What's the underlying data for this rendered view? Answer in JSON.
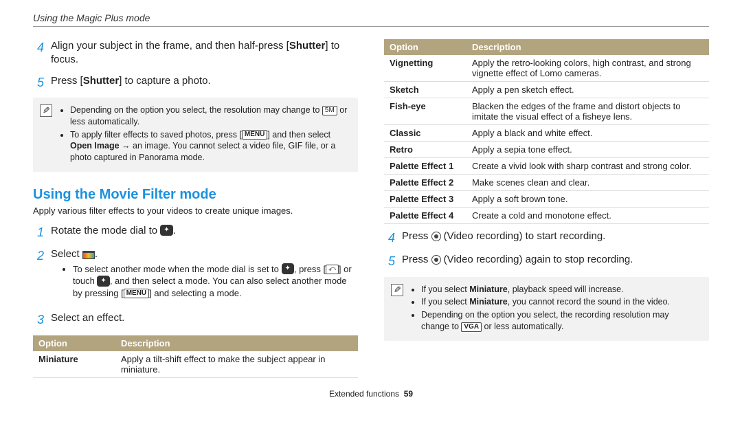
{
  "breadcrumb": "Using the Magic Plus mode",
  "left": {
    "step4_a": "Align your subject in the frame, and then half-press [",
    "step4_b": "Shutter",
    "step4_c": "] to focus.",
    "step5_a": "Press [",
    "step5_b": "Shutter",
    "step5_c": "] to capture a photo.",
    "notes": {
      "n1_a": "Depending on the option you select, the resolution may change to ",
      "n1_icon": "5M",
      "n1_b": " or less automatically.",
      "n2_a": "To apply filter effects to saved photos, press [",
      "n2_menu": "MENU",
      "n2_b": "] and then select ",
      "n2_bold": "Open Image",
      "n2_c": " → an image. You cannot select a video file, GIF file, or a photo captured in Panorama mode."
    },
    "section_title": "Using the Movie Filter mode",
    "section_desc": "Apply various filter effects to your videos to create unique images.",
    "mf_step1_a": "Rotate the mode dial to ",
    "mf_step1_icon": "✦",
    "mf_step1_b": ".",
    "mf_step2_a": "Select ",
    "mf_step2_b": ".",
    "mf_sub_a": "To select another mode when the mode dial is set to ",
    "mf_sub_icon1": "✦",
    "mf_sub_b": ", press [",
    "mf_sub_icon2": "⤺",
    "mf_sub_c": "] or touch ",
    "mf_sub_icon3": "✦",
    "mf_sub_d": ", and then select a mode. You can also select another mode by pressing [",
    "mf_sub_menu": "MENU",
    "mf_sub_e": "] and selecting a mode.",
    "mf_step3": "Select an effect.",
    "table_h1": "Option",
    "table_h2": "Description",
    "t_miniature": "Miniature",
    "t_miniature_desc": "Apply a tilt-shift effect to make the subject appear in miniature."
  },
  "right": {
    "table_h1": "Option",
    "table_h2": "Description",
    "rows": {
      "vignetting": {
        "o": "Vignetting",
        "d": "Apply the retro-looking colors, high contrast, and strong vignette effect of Lomo cameras."
      },
      "sketch": {
        "o": "Sketch",
        "d": "Apply a pen sketch effect."
      },
      "fisheye": {
        "o": "Fish-eye",
        "d": "Blacken the edges of the frame and distort objects to imitate the visual effect of a fisheye lens."
      },
      "classic": {
        "o": "Classic",
        "d": "Apply a black and white effect."
      },
      "retro": {
        "o": "Retro",
        "d": "Apply a sepia tone effect."
      },
      "pe1": {
        "o": "Palette Effect 1",
        "d": "Create a vivid look with sharp contrast and strong color."
      },
      "pe2": {
        "o": "Palette Effect 2",
        "d": "Make scenes clean and clear."
      },
      "pe3": {
        "o": "Palette Effect 3",
        "d": "Apply a soft brown tone."
      },
      "pe4": {
        "o": "Palette Effect 4",
        "d": "Create a cold and monotone effect."
      }
    },
    "step4_a": "Press ",
    "step4_b": " (Video recording) to start recording.",
    "step5_a": "Press ",
    "step5_b": " (Video recording) again to stop recording.",
    "notes": {
      "n1_a": "If you select ",
      "n1_bold": "Miniature",
      "n1_b": ", playback speed will increase.",
      "n2_a": "If you select ",
      "n2_bold": "Miniature",
      "n2_b": ", you cannot record the sound in the video.",
      "n3_a": "Depending on the option you select, the recording resolution may change to ",
      "n3_icon": "VGA",
      "n3_b": " or less automatically."
    }
  },
  "footer_label": "Extended functions",
  "footer_page": "59"
}
